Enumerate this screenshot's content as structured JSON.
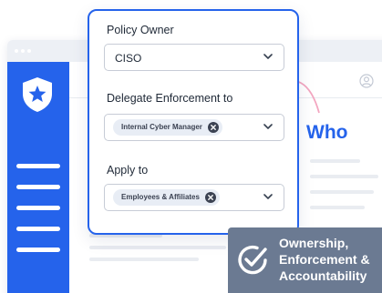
{
  "form": {
    "policy_owner": {
      "label": "Policy Owner",
      "value": "CISO"
    },
    "delegate": {
      "label": "Delegate Enforcement to",
      "chip": "Internal Cyber Manager"
    },
    "apply_to": {
      "label": "Apply to",
      "chip": "Employees & Affiliates"
    }
  },
  "callout": {
    "text": "Who"
  },
  "banner": {
    "lines": [
      "Ownership,",
      "Enforcement &",
      "Accountability"
    ]
  },
  "colors": {
    "accent": "#2563eb",
    "callout_dot": "#ee5f8a",
    "banner": "#6b7a92"
  },
  "icons": [
    "shield-star-icon",
    "user-circle-icon",
    "chevron-down-icon",
    "close-circle-icon",
    "check-badge-icon"
  ]
}
